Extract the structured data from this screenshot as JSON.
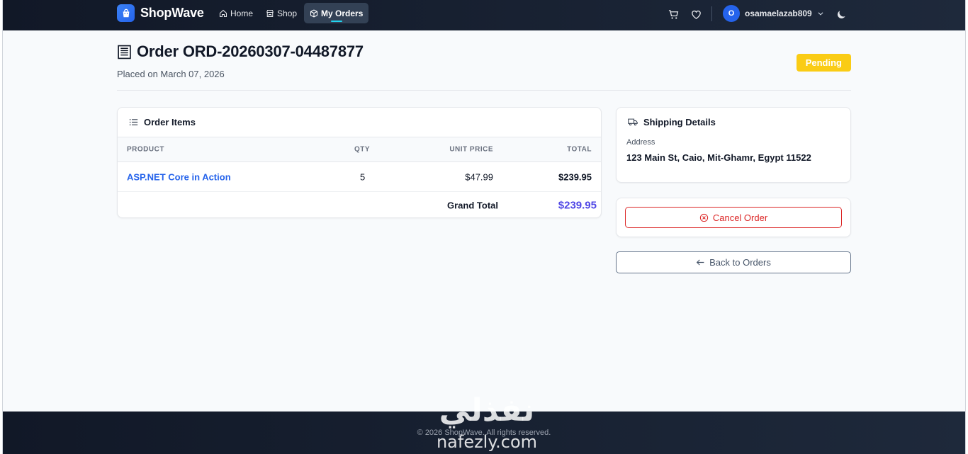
{
  "navbar": {
    "brand": "ShopWave",
    "links": [
      {
        "label": "Home",
        "icon": "home-icon"
      },
      {
        "label": "Shop",
        "icon": "store-icon"
      },
      {
        "label": "My Orders",
        "icon": "box-icon",
        "active": true
      }
    ],
    "cart_icon": "cart-icon",
    "wishlist_icon": "heart-icon",
    "user": {
      "initial": "O",
      "name": "osamaelazab809"
    },
    "theme_icon": "moon-icon"
  },
  "order": {
    "title": "Order ORD-20260307-04487877",
    "placed": "Placed on March 07, 2026",
    "status": "Pending",
    "status_color": "#facc15"
  },
  "items_card": {
    "title": "Order Items",
    "columns": [
      "PRODUCT",
      "QTY",
      "UNIT PRICE",
      "TOTAL"
    ],
    "rows": [
      {
        "product": "ASP.NET Core in Action",
        "qty": "5",
        "unit_price": "$47.99",
        "total": "$239.95"
      }
    ],
    "grand_total_label": "Grand Total",
    "grand_total_value": "$239.95"
  },
  "shipping": {
    "title": "Shipping Details",
    "address_label": "Address",
    "address_value": "123 Main St, Caio, Mit-Ghamr, Egypt 11522"
  },
  "actions": {
    "cancel_label": "Cancel Order",
    "back_label": "Back to Orders"
  },
  "footer": {
    "text": "© 2026 ShopWave. All rights reserved."
  },
  "watermark": {
    "arabic": "نفذلي",
    "latin": "nafezly.com"
  },
  "colors": {
    "accent": "#2563eb",
    "danger": "#dc2626",
    "grand_total": "#4f46e5",
    "nav_bg": "#111827"
  }
}
